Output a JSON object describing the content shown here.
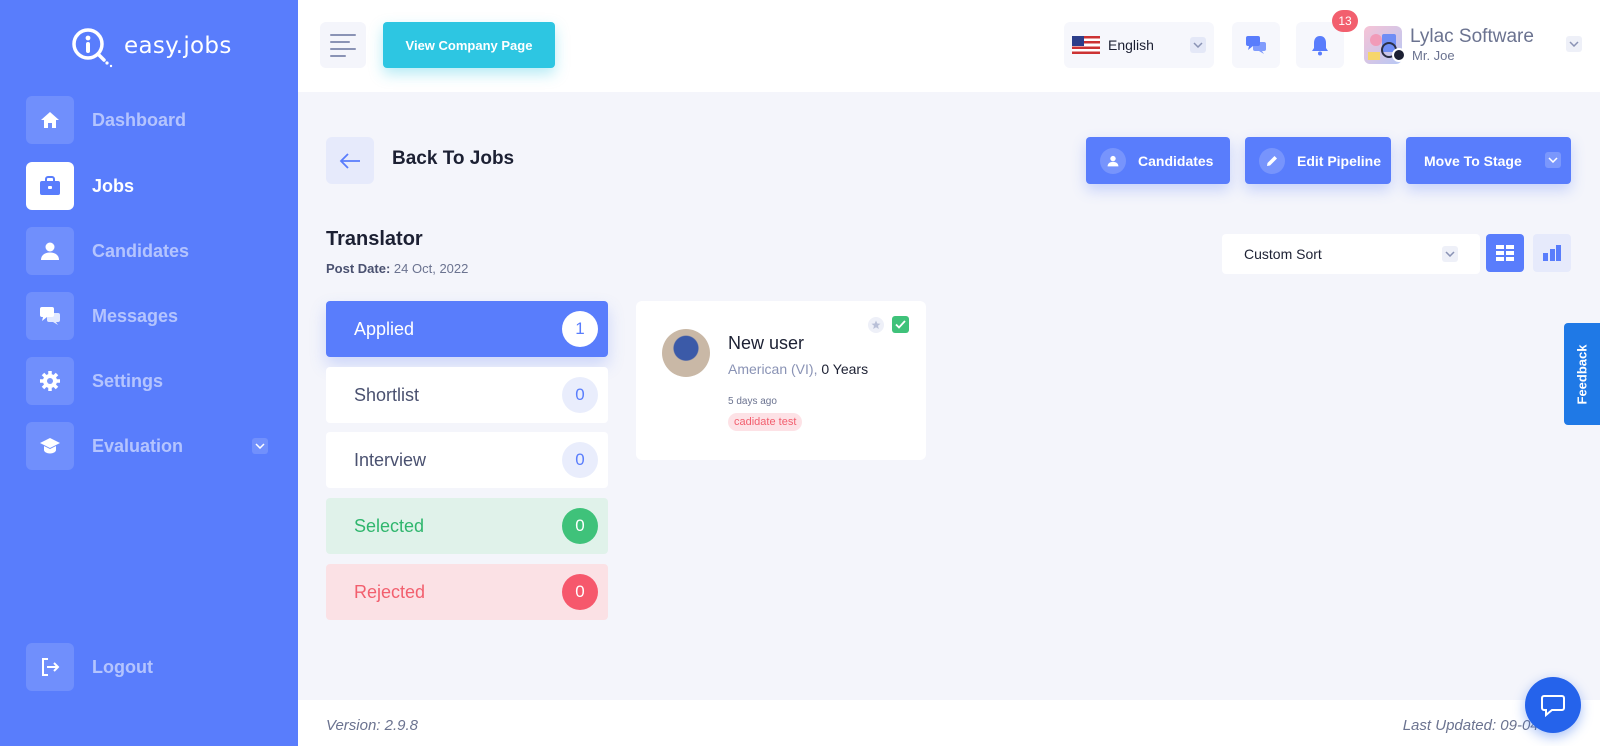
{
  "brand": {
    "name": "easy.jobs"
  },
  "sidebar": {
    "items": [
      {
        "label": "Dashboard",
        "icon": "home-icon"
      },
      {
        "label": "Jobs",
        "icon": "briefcase-icon",
        "active": true
      },
      {
        "label": "Candidates",
        "icon": "user-icon"
      },
      {
        "label": "Messages",
        "icon": "messages-icon"
      },
      {
        "label": "Settings",
        "icon": "gear-icon"
      },
      {
        "label": "Evaluation",
        "icon": "graduation-cap-icon"
      }
    ],
    "logout": {
      "label": "Logout",
      "icon": "logout-icon"
    }
  },
  "header": {
    "company_page_label": "View Company Page",
    "language": "English",
    "notification_count": "13",
    "company_name": "Lylac Software",
    "user_name": "Mr. Joe"
  },
  "page": {
    "back_label": "Back To Jobs",
    "actions": {
      "candidates": "Candidates",
      "edit_pipeline": "Edit Pipeline",
      "move_to_stage": "Move To Stage"
    },
    "job_title": "Translator",
    "post_date_label": "Post Date:",
    "post_date_value": "24 Oct, 2022",
    "sort": {
      "selected": "Custom Sort"
    }
  },
  "stages": [
    {
      "name": "Applied",
      "count": "1"
    },
    {
      "name": "Shortlist",
      "count": "0"
    },
    {
      "name": "Interview",
      "count": "0"
    },
    {
      "name": "Selected",
      "count": "0"
    },
    {
      "name": "Rejected",
      "count": "0"
    }
  ],
  "candidate": {
    "name": "New user",
    "nationality": "American (VI),",
    "experience": "0 Years",
    "time_ago": "5 days ago",
    "tag": "cadidate test"
  },
  "feedback_label": "Feedback",
  "footer": {
    "version": "Version: 2.9.8",
    "last_updated": "Last Updated: 09-04-2"
  },
  "colors": {
    "primary": "#597dfc",
    "cyan": "#2dc6e2",
    "success": "#3fc27a",
    "danger": "#f6586c",
    "feedback": "#1f79e6"
  }
}
